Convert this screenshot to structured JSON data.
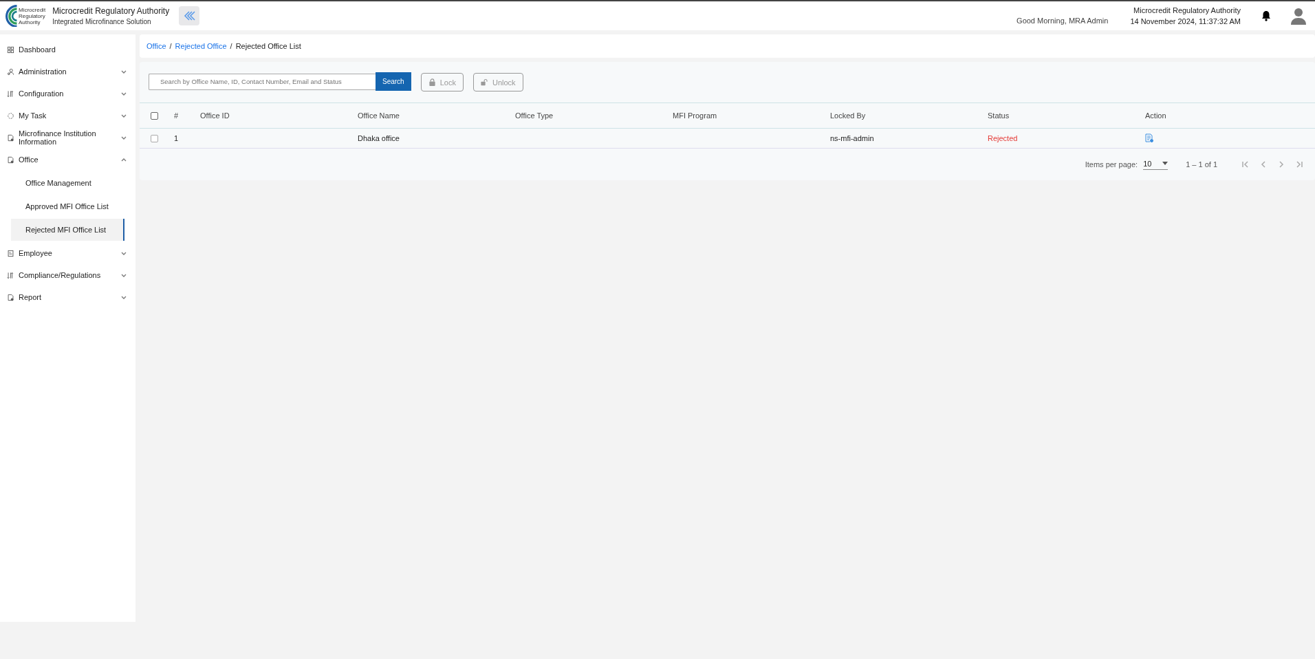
{
  "header": {
    "org_name": "Microcredit Regulatory Authority",
    "subtitle": "Integrated Microfinance Solution",
    "greeting": "Good Morning, MRA Admin",
    "right_org": "Microcredit Regulatory Authority",
    "datetime": "14 November 2024, 11:37:32 AM",
    "logo_text": [
      "Microcredit",
      "Regulatory",
      "Authority"
    ]
  },
  "sidebar": {
    "items": [
      {
        "label": "Dashboard",
        "kind": "link"
      },
      {
        "label": "Administration",
        "kind": "group",
        "expanded": false
      },
      {
        "label": "Configuration",
        "kind": "group",
        "expanded": false
      },
      {
        "label": "My Task",
        "kind": "group",
        "expanded": false
      },
      {
        "label": "Microfinance Institution Information",
        "kind": "group",
        "expanded": false
      },
      {
        "label": "Office",
        "kind": "group",
        "expanded": true,
        "children": [
          {
            "label": "Office Management",
            "selected": false
          },
          {
            "label": "Approved MFI Office List",
            "selected": false
          },
          {
            "label": "Rejected MFI Office List",
            "selected": true
          }
        ]
      },
      {
        "label": "Employee",
        "kind": "group",
        "expanded": false
      },
      {
        "label": "Compliance/Regulations",
        "kind": "group",
        "expanded": false
      },
      {
        "label": "Report",
        "kind": "group",
        "expanded": false
      }
    ]
  },
  "breadcrumb": [
    {
      "label": "Office",
      "kind": "link"
    },
    {
      "separator": "/",
      "label": "Rejected Office",
      "kind": "link"
    },
    {
      "separator": "/",
      "label": "Rejected Office List",
      "kind": "current"
    }
  ],
  "toolbar": {
    "search": {
      "placeholder": "Search by Office Name, ID, Contact Number, Email and Status"
    },
    "search_button": "Search",
    "lock_button": {
      "label": "Lock",
      "disabled": true
    },
    "unlock_button": {
      "label": "Unlock",
      "disabled": true
    }
  },
  "table": {
    "all_checked": false,
    "columns": [
      "#",
      "Office ID",
      "Office Name",
      "Office Type",
      "MFI Program",
      "Locked By",
      "Status",
      "Action"
    ],
    "rows": [
      {
        "checked": false,
        "number": "1",
        "office_id": "",
        "office_name": "Dhaka office",
        "office_type": "",
        "mfi_program": "",
        "locked_by": "ns-mfi-admin",
        "status": "Rejected"
      }
    ]
  },
  "paginator": {
    "label": "Items per page:",
    "page_size": "10",
    "range": "1 – 1 of 1"
  }
}
